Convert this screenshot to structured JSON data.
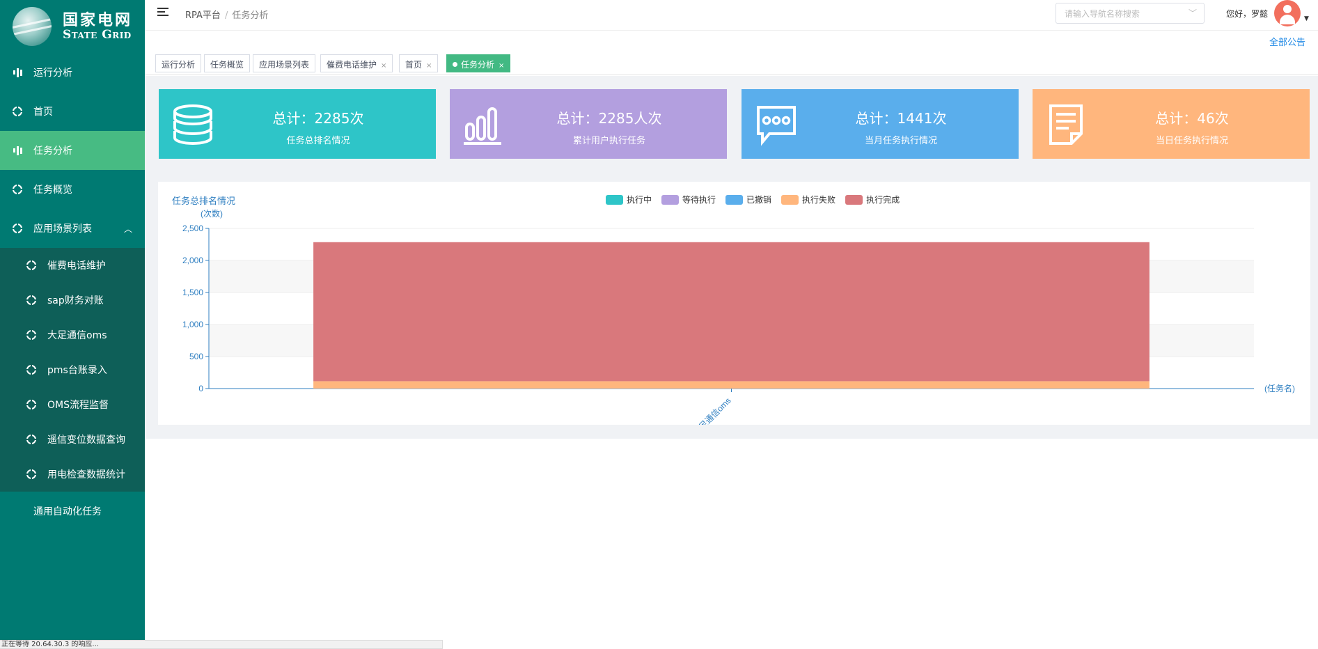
{
  "brand": {
    "cn": "国家电网",
    "en": "State Grid"
  },
  "sidebar": {
    "items": [
      {
        "label": "运行分析",
        "icon": "bar-chart-icon"
      },
      {
        "label": "首页",
        "icon": "crosshair-icon"
      },
      {
        "label": "任务分析",
        "icon": "bar-chart-icon",
        "active": true
      },
      {
        "label": "任务概览",
        "icon": "crosshair-icon"
      },
      {
        "label": "应用场景列表",
        "icon": "crosshair-icon",
        "expanded": true
      }
    ],
    "subitems": [
      {
        "label": "催费电话维护"
      },
      {
        "label": "sap财务对账"
      },
      {
        "label": "大足通信oms"
      },
      {
        "label": "pms台账录入"
      },
      {
        "label": "OMS流程监督"
      },
      {
        "label": "遥信变位数据查询"
      },
      {
        "label": "用电检查数据统计"
      }
    ],
    "last_item": {
      "label": "通用自动化任务",
      "icon": "table-icon"
    }
  },
  "header": {
    "breadcrumb": {
      "root": "RPA平台",
      "sep": "/",
      "current": "任务分析"
    },
    "search_placeholder": "请输入导航名称搜索",
    "greeting": "您好，罗懿",
    "announcement": "全部公告"
  },
  "tabs": [
    {
      "label": "运行分析",
      "closable": false
    },
    {
      "label": "任务概览",
      "closable": false
    },
    {
      "label": "应用场景列表",
      "closable": false
    },
    {
      "label": "催费电话维护",
      "closable": true
    },
    {
      "label": "首页",
      "closable": true
    },
    {
      "label": "任务分析",
      "closable": true,
      "active": true
    }
  ],
  "tab_close": "×",
  "cards": [
    {
      "total": "总计：2285次",
      "desc": "任务总排名情况",
      "color": "#2ec5c8",
      "icon": "database-icon"
    },
    {
      "total": "总计：2285人次",
      "desc": "累计用户执行任务",
      "color": "#b39fdf",
      "icon": "bar-chart-icon"
    },
    {
      "total": "总计：1441次",
      "desc": "当月任务执行情况",
      "color": "#5aaeec",
      "icon": "chat-bubble-icon"
    },
    {
      "total": "总计：46次",
      "desc": "当日任务执行情况",
      "color": "#ffb67d",
      "icon": "document-icon"
    }
  ],
  "chart_data": {
    "type": "bar",
    "stacked": true,
    "title": "任务总排名情况",
    "ylabel": "(次数)",
    "xlabel": "(任务名)",
    "categories": [
      "大足通信oms"
    ],
    "ylim": [
      0,
      2500
    ],
    "yticks": [
      0,
      500,
      1000,
      1500,
      2000,
      2500
    ],
    "ytick_labels": [
      "0",
      "500",
      "1,000",
      "1,500",
      "2,000",
      "2,500"
    ],
    "series": [
      {
        "name": "执行中",
        "color": "#2ec5c8",
        "values": [
          0
        ]
      },
      {
        "name": "等待执行",
        "color": "#b39fdf",
        "values": [
          0
        ]
      },
      {
        "name": "已撤销",
        "color": "#5aaeec",
        "values": [
          0
        ]
      },
      {
        "name": "执行失败",
        "color": "#ffb67d",
        "values": [
          115
        ]
      },
      {
        "name": "执行完成",
        "color": "#d9787c",
        "values": [
          2170
        ]
      }
    ],
    "legend_position": "top-center",
    "grid": true
  },
  "statusbar": "正在等待 20.64.30.3 的响应..."
}
